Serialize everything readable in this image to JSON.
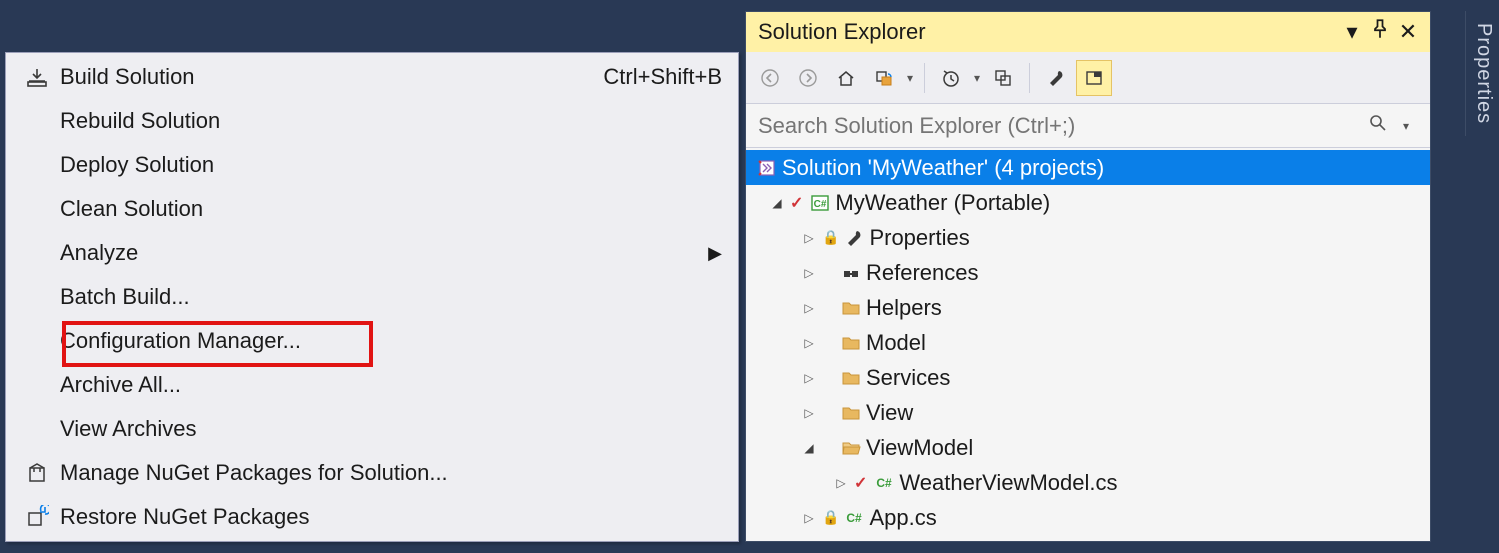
{
  "contextMenu": {
    "items": [
      {
        "label": "Build Solution",
        "shortcut": "Ctrl+Shift+B",
        "icon": "build",
        "submenu": false
      },
      {
        "label": "Rebuild Solution",
        "shortcut": "",
        "icon": "",
        "submenu": false
      },
      {
        "label": "Deploy Solution",
        "shortcut": "",
        "icon": "",
        "submenu": false
      },
      {
        "label": "Clean Solution",
        "shortcut": "",
        "icon": "",
        "submenu": false
      },
      {
        "label": "Analyze",
        "shortcut": "",
        "icon": "",
        "submenu": true
      },
      {
        "label": "Batch Build...",
        "shortcut": "",
        "icon": "",
        "submenu": false
      },
      {
        "label": "Configuration Manager...",
        "shortcut": "",
        "icon": "",
        "submenu": false,
        "highlighted": true
      },
      {
        "label": "Archive All...",
        "shortcut": "",
        "icon": "",
        "submenu": false
      },
      {
        "label": "View Archives",
        "shortcut": "",
        "icon": "",
        "submenu": false
      },
      {
        "label": "Manage NuGet Packages for Solution...",
        "shortcut": "",
        "icon": "nuget",
        "submenu": false
      },
      {
        "label": "Restore NuGet Packages",
        "shortcut": "",
        "icon": "restore-nuget",
        "submenu": false
      }
    ]
  },
  "solutionExplorer": {
    "title": "Solution Explorer",
    "searchPlaceholder": "Search Solution Explorer (Ctrl+;)",
    "tree": {
      "solution": "Solution 'MyWeather' (4 projects)",
      "project": "MyWeather (Portable)",
      "nodes": [
        {
          "label": "Properties",
          "icon": "properties",
          "expander": "closed",
          "indent": 2
        },
        {
          "label": "References",
          "icon": "references",
          "expander": "closed",
          "indent": 2
        },
        {
          "label": "Helpers",
          "icon": "folder",
          "expander": "closed",
          "indent": 2
        },
        {
          "label": "Model",
          "icon": "folder",
          "expander": "closed",
          "indent": 2
        },
        {
          "label": "Services",
          "icon": "folder",
          "expander": "closed",
          "indent": 2
        },
        {
          "label": "View",
          "icon": "folder",
          "expander": "closed",
          "indent": 2
        },
        {
          "label": "ViewModel",
          "icon": "folder-open",
          "expander": "open",
          "indent": 2
        },
        {
          "label": "WeatherViewModel.cs",
          "icon": "cs-file",
          "expander": "closed",
          "indent": 3,
          "checked": true
        },
        {
          "label": "App.cs",
          "icon": "cs-file",
          "expander": "closed",
          "indent": 2,
          "checked": false,
          "lock": true
        }
      ]
    }
  },
  "sideTab": "Properties"
}
